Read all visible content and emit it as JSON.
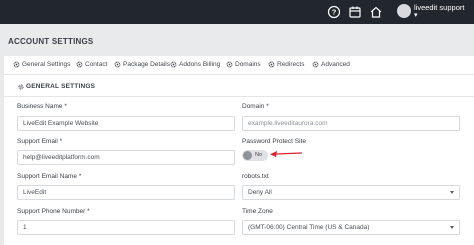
{
  "topbar": {
    "icons": [
      "help-icon",
      "calendar-icon",
      "home-icon"
    ],
    "user": {
      "name": "liveedit support",
      "caret": "▾"
    }
  },
  "page": {
    "title": "ACCOUNT SETTINGS"
  },
  "tabs": [
    {
      "label": "General Settings",
      "icon": "gear-icon"
    },
    {
      "label": "Contact",
      "icon": "gear-icon"
    },
    {
      "label": "Package Details",
      "icon": "gear-icon"
    },
    {
      "label": "Addons Billing",
      "icon": "gear-icon"
    },
    {
      "label": "Domains",
      "icon": "gear-icon"
    },
    {
      "label": "Redirects",
      "icon": "gear-icon"
    },
    {
      "label": "Advanced",
      "icon": "gear-icon"
    }
  ],
  "section": {
    "title": "GENERAL SETTINGS",
    "icon": "gear-icon"
  },
  "form": {
    "business_name": {
      "label": "Business Name *",
      "value": "LiveEdit Example Website"
    },
    "domain": {
      "label": "Domain *",
      "placeholder": "example.liveeditaurora.com"
    },
    "support_email": {
      "label": "Support Email *",
      "value": "help@liveeditplatform.com"
    },
    "password_protect": {
      "label": "Password Protect Site",
      "value": "No"
    },
    "support_email_name": {
      "label": "Support Email Name *",
      "value": "LiveEdit"
    },
    "robots": {
      "label": "robots.txt",
      "value": "Deny All"
    },
    "support_phone": {
      "label": "Support Phone Number *",
      "value": "1"
    },
    "time_zone": {
      "label": "Time Zone",
      "value": "(GMT-06:00) Central Time (US & Canada)"
    }
  },
  "colors": {
    "topbar": "#22272d",
    "page_bg": "#e9eaec",
    "annotation_arrow": "#e0242c"
  }
}
